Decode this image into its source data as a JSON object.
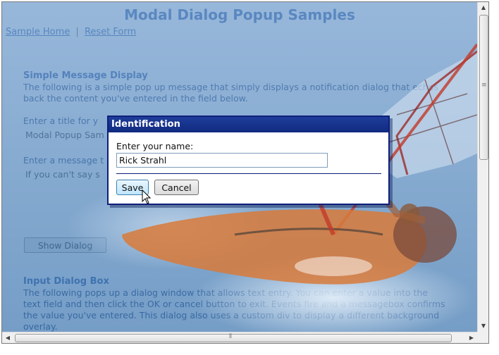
{
  "page": {
    "title": "Modal Dialog Popup Samples",
    "nav": {
      "home": "Sample Home",
      "separator": "|",
      "reset": "Reset Form"
    }
  },
  "simple_section": {
    "heading": "Simple Message Display",
    "description": "The following is a simple pop up message that simply displays a notification dialog that echos back the content you've entered in the field below.",
    "title_label": "Enter a title for y",
    "title_value": "Modal Popup Sam",
    "message_label": "Enter a message t",
    "message_value": "If you can't say s",
    "show_button": "Show Dialog"
  },
  "input_section": {
    "heading": "Input Dialog Box",
    "description": "The following pops up a dialog window that allows text entry. You can enter a value into the text field and then click the OK or cancel button to exit. Events fire and a messagebox confirms the value you've entered. This dialog also uses a custom div to display a different background overlay."
  },
  "dialog": {
    "title": "Identification",
    "prompt": "Enter your name:",
    "name_value": "Rick Strahl",
    "save_label": "Save",
    "cancel_label": "Cancel"
  },
  "colors": {
    "heading_blue": "#2a56a6",
    "dialog_titlebar": "#102a80",
    "overlay_tint": "#4a7fb8"
  },
  "icons": {
    "cursor": "mouse-pointer-icon",
    "scroll_up": "scroll-up-arrow-icon",
    "scroll_down": "scroll-down-arrow-icon",
    "scroll_left": "scroll-left-arrow-icon",
    "scroll_right": "scroll-right-arrow-icon"
  }
}
